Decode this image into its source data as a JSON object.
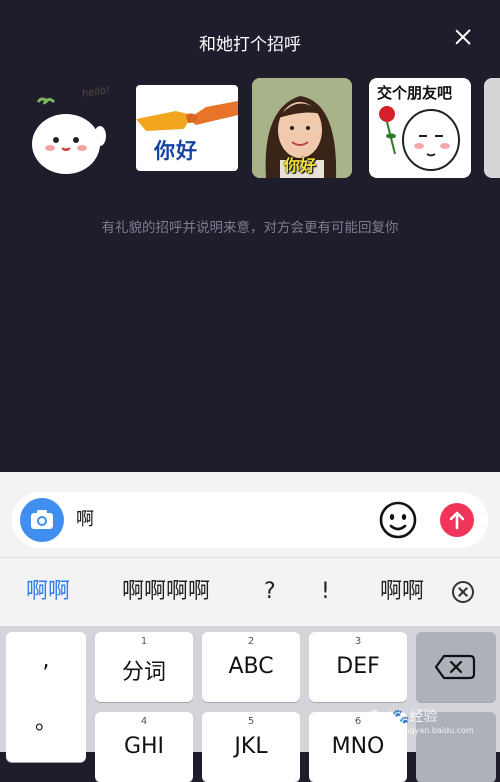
{
  "header": {
    "title": "和她打个招呼"
  },
  "stickers": [
    {
      "name": "hello-sticker",
      "text": "hello!"
    },
    {
      "name": "handshake-sticker",
      "text": "你好"
    },
    {
      "name": "girl-sticker",
      "text": "你好"
    },
    {
      "name": "rose-sticker",
      "text": "交个朋友吧"
    }
  ],
  "hint": "有礼貌的招呼并说明来意，对方会更有可能回复你",
  "input": {
    "value": "啊"
  },
  "candidates": [
    "啊啊",
    "啊啊啊啊",
    "?",
    "!",
    "啊啊"
  ],
  "keyboard": {
    "left_symbols": [
      ",",
      "。"
    ],
    "keys": [
      {
        "number": "1",
        "label": "分词"
      },
      {
        "number": "2",
        "label": "ABC"
      },
      {
        "number": "3",
        "label": "DEF"
      },
      {
        "number": "4",
        "label": "GHI"
      },
      {
        "number": "5",
        "label": "JKL"
      },
      {
        "number": "6",
        "label": "MNO"
      }
    ]
  },
  "watermark": {
    "brand": "Bai",
    "suffix": "经验",
    "url": "jingyan.baidu.com"
  },
  "colors": {
    "background": "#1d1d2c",
    "accent_blue": "#3f8ef0",
    "send_red": "#f0345a",
    "candidate_highlight": "#2e7cf0"
  }
}
